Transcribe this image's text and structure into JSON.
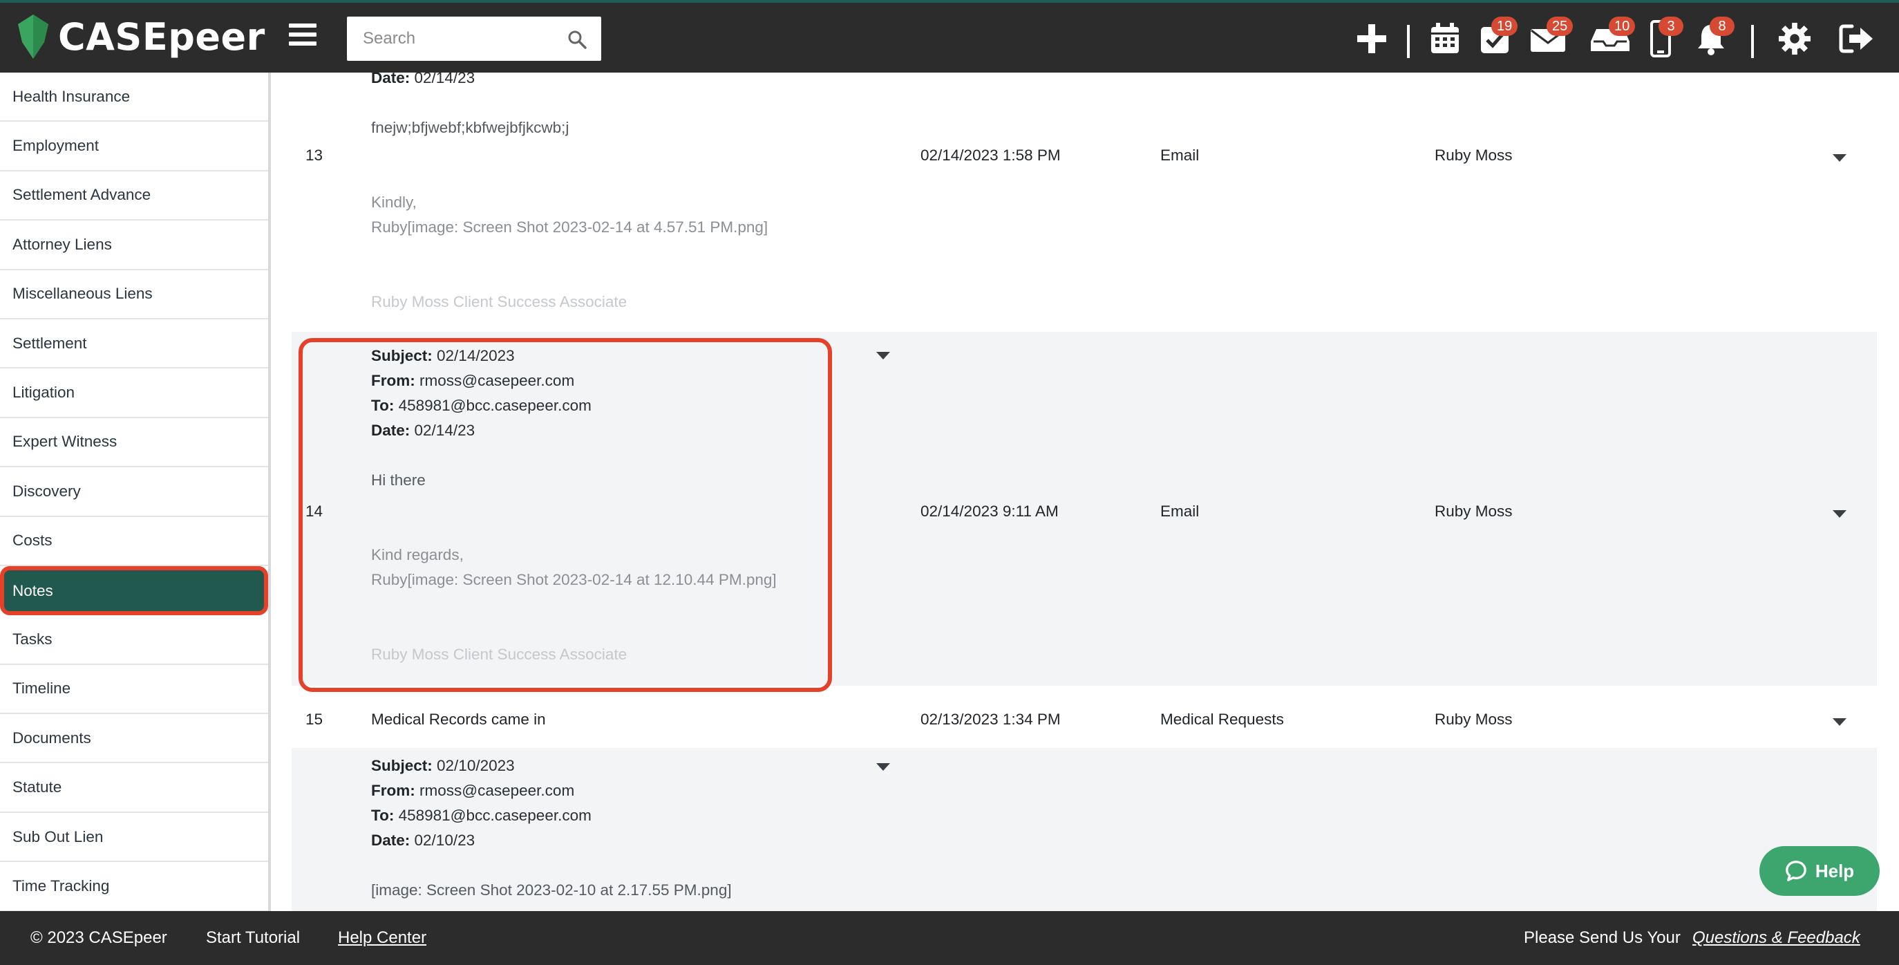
{
  "brand": {
    "name": "CASEpeer"
  },
  "search": {
    "placeholder": "Search"
  },
  "topbar": {
    "badges": {
      "tasks": "19",
      "mail": "25",
      "inbox": "10",
      "mobile": "3",
      "notifications": "8"
    }
  },
  "sidebar": {
    "items": [
      {
        "label": "Health Insurance"
      },
      {
        "label": "Employment"
      },
      {
        "label": "Settlement Advance"
      },
      {
        "label": "Attorney Liens"
      },
      {
        "label": "Miscellaneous Liens"
      },
      {
        "label": "Settlement"
      },
      {
        "label": "Litigation"
      },
      {
        "label": "Expert Witness"
      },
      {
        "label": "Discovery"
      },
      {
        "label": "Costs"
      },
      {
        "label": "Notes"
      },
      {
        "label": "Tasks"
      },
      {
        "label": "Timeline"
      },
      {
        "label": "Documents"
      },
      {
        "label": "Statute"
      },
      {
        "label": "Sub Out Lien"
      },
      {
        "label": "Time Tracking"
      }
    ],
    "active": "Notes"
  },
  "notes": {
    "labels": {
      "subject": "Subject:",
      "from": "From:",
      "to": "To:",
      "date": "Date:"
    },
    "row13": {
      "number": "13",
      "date_partial_value": "02/14/23",
      "line1": "fnejw;bfjwebf;kbfwejbfjkcwb;j",
      "datetime": "02/14/2023 1:58 PM",
      "type": "Email",
      "user": "Ruby Moss",
      "sign1": "Kindly,",
      "sign2": "Ruby[image: Screen Shot 2023-02-14 at 4.57.51 PM.png]",
      "signature": "Ruby Moss  Client Success Associate"
    },
    "row14": {
      "number": "14",
      "subject": "02/14/2023",
      "from": "rmoss@casepeer.com",
      "to": "458981@bcc.casepeer.com",
      "date": "02/14/23",
      "body": "Hi there",
      "sign1": "Kind regards,",
      "sign2": "Ruby[image: Screen Shot 2023-02-14 at 12.10.44 PM.png]",
      "signature": "Ruby Moss  Client Success Associate",
      "datetime": "02/14/2023 9:11 AM",
      "type": "Email",
      "user": "Ruby Moss"
    },
    "row15": {
      "number": "15",
      "text": "Medical Records came in",
      "datetime": "02/13/2023 1:34 PM",
      "type": "Medical Requests",
      "user": "Ruby Moss"
    },
    "row16": {
      "subject": "02/10/2023",
      "from": "rmoss@casepeer.com",
      "to": "458981@bcc.casepeer.com",
      "date": "02/10/23",
      "body": "[image: Screen Shot 2023-02-10 at 2.17.55 PM.png]"
    }
  },
  "help": {
    "label": "Help"
  },
  "footer": {
    "copyright": "© 2023 CASEpeer",
    "tutorial": "Start Tutorial",
    "help_center": "Help Center",
    "feedback_prefix": "Please Send Us Your",
    "feedback_link": "Questions & Feedback"
  },
  "colors": {
    "brand_green": "#22594f",
    "accent_red": "#e4402a",
    "badge_red": "#d64a33",
    "topbar": "#2c2c2c",
    "help_green": "#3da66f"
  }
}
